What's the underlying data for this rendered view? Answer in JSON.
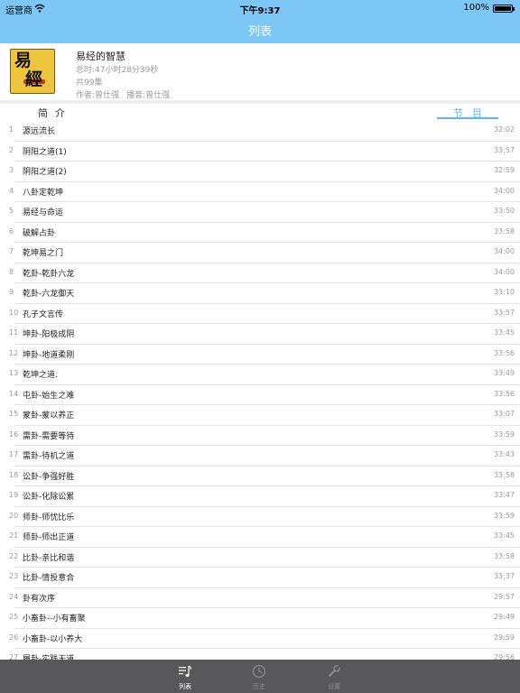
{
  "statusbar": {
    "carrier": "运营商",
    "time": "下午9:37",
    "battery": "100%"
  },
  "navbar": {
    "title": "列表"
  },
  "album": {
    "title": "易经的智慧",
    "duration": "总时:47小时28分39秒",
    "count": "共99集",
    "author": "作者:曾仕强",
    "narrator": "播音:曾仕强",
    "cover_chars": [
      "易",
      "經"
    ]
  },
  "tabs": {
    "intro": "简介",
    "episodes": "节目"
  },
  "episodes": [
    {
      "num": "1",
      "title": "源远流长",
      "duration": "32:02"
    },
    {
      "num": "2",
      "title": "阴阳之道(1)",
      "duration": "33:57"
    },
    {
      "num": "3",
      "title": "阴阳之道(2)",
      "duration": "32:59"
    },
    {
      "num": "4",
      "title": "八卦定乾坤",
      "duration": "34:00"
    },
    {
      "num": "5",
      "title": "易经与命运",
      "duration": "33:50"
    },
    {
      "num": "6",
      "title": "破解占卦",
      "duration": "33:58"
    },
    {
      "num": "7",
      "title": "乾坤易之门",
      "duration": "34:00"
    },
    {
      "num": "8",
      "title": "乾卦-乾卦六龙",
      "duration": "34:00"
    },
    {
      "num": "9",
      "title": "乾卦-六龙御天",
      "duration": "33:10"
    },
    {
      "num": "10",
      "title": "孔子文言传",
      "duration": "33:57"
    },
    {
      "num": "11",
      "title": "坤卦-阳极成阴",
      "duration": "33:45"
    },
    {
      "num": "12",
      "title": "坤卦-地道柔刚",
      "duration": "33:56"
    },
    {
      "num": "13",
      "title": "乾坤之道.",
      "duration": "33:49"
    },
    {
      "num": "14",
      "title": "屯卦-始生之难",
      "duration": "33:56"
    },
    {
      "num": "15",
      "title": "蒙卦-蒙以养正",
      "duration": "33:07"
    },
    {
      "num": "16",
      "title": "需卦-需要等待",
      "duration": "33:59"
    },
    {
      "num": "17",
      "title": "需卦-待机之道",
      "duration": "33:43"
    },
    {
      "num": "18",
      "title": "讼卦-争强好胜",
      "duration": "33:58"
    },
    {
      "num": "19",
      "title": "讼卦-化除讼累",
      "duration": "33:47"
    },
    {
      "num": "20",
      "title": "师卦-师忧比乐",
      "duration": "33:59"
    },
    {
      "num": "21",
      "title": "师卦-师出正道",
      "duration": "33:45"
    },
    {
      "num": "22",
      "title": "比卦-亲比和谐",
      "duration": "33:58"
    },
    {
      "num": "23",
      "title": "比卦-情投意合",
      "duration": "33:37"
    },
    {
      "num": "24",
      "title": "卦有次序",
      "duration": "29:57"
    },
    {
      "num": "25",
      "title": "小畜卦--小有畜聚",
      "duration": "29:49"
    },
    {
      "num": "26",
      "title": "小畜卦-以小养大",
      "duration": "29:59"
    },
    {
      "num": "27",
      "title": "履卦-实践天道",
      "duration": "29:56"
    }
  ],
  "tabbar": {
    "list": {
      "label": "列表",
      "icon": "music-list-icon"
    },
    "history": {
      "label": "历史",
      "icon": "clock-icon"
    },
    "settings": {
      "label": "设置",
      "icon": "wrench-icon"
    }
  },
  "colors": {
    "accent": "#7cc7f5",
    "tab_active": "#5ab8ef",
    "tabbar_bg": "#58585a"
  }
}
